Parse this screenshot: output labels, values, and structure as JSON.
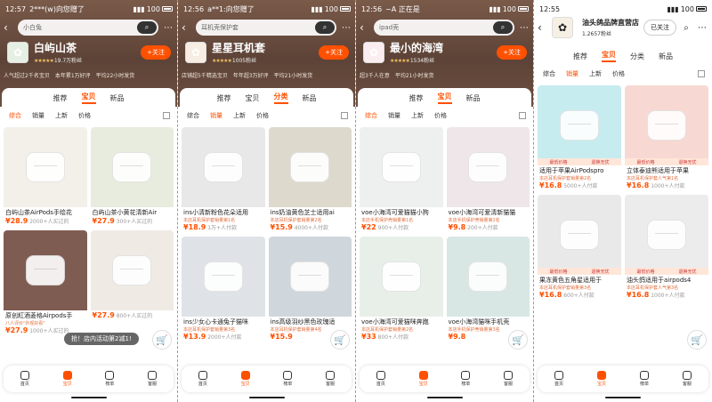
{
  "panels": [
    {
      "theme": "dark",
      "status": {
        "time": "12:57",
        "carrier": "2***(w)向您赠了",
        "battery": "100"
      },
      "search": {
        "query": "小白兔"
      },
      "shop": {
        "name": "白屿山茶",
        "fans": "19.7万粉丝",
        "follow": "+关注",
        "logo_color": "#e6efe3"
      },
      "tags": [
        "人气超过2千名宝贝",
        "本年累1万好评",
        "平均22小时发货"
      ],
      "tabs": [
        "推荐",
        "宝贝",
        "新品"
      ],
      "active_tab": 1,
      "sorts": [
        "综合",
        "销量",
        "上新",
        "价格"
      ],
      "active_sort": 0,
      "columns": [
        [
          {
            "title": "白屿山茶AirPods手绘花",
            "sub": "",
            "price": "¥28.9",
            "sales": "2000+人买过的",
            "img": "#f3f0ea"
          },
          {
            "title": "原创紅酒菱格Airpods手",
            "sub": "八人评价\"外观好看\"",
            "price": "¥27.9",
            "sales": "1000+人买过的",
            "img": "#7f5c52"
          }
        ],
        [
          {
            "title": "白屿山茶小黄花清新Air",
            "sub": "",
            "price": "¥27.9",
            "sales": "300+人买过的",
            "img": "#e7ecde"
          },
          {
            "title": "",
            "sub": "",
            "price": "¥27.9",
            "sales": "800+人买过的",
            "img": "#efeae4"
          }
        ]
      ],
      "toast": "抢！店内活动第2减1!",
      "nav": [
        "首页",
        "宝贝",
        "榜单",
        "客服"
      ],
      "active_nav": 1
    },
    {
      "theme": "dark",
      "status": {
        "time": "12:56",
        "carrier": "a**1:向您赠了",
        "battery": "100"
      },
      "search": {
        "query": "耳机壳保护套"
      },
      "shop": {
        "name": "星星耳机套",
        "fans": "1005粉丝",
        "follow": "+关注",
        "logo_color": "#f7ede2"
      },
      "tags": [
        "店铺超5千精选宝贝",
        "年年超3万好评",
        "平均21小时发货"
      ],
      "tabs": [
        "推荐",
        "宝贝",
        "分类",
        "新品"
      ],
      "active_tab": 2,
      "sorts": [
        "综合",
        "销量",
        "上新",
        "价格"
      ],
      "active_sort": 1,
      "columns": [
        [
          {
            "title": "ins小清新粉色花朵适用",
            "sub": "本店耳机保护套销量第1名",
            "price": "¥18.9",
            "sales": "1万+人付款",
            "img": "#e8e8e8"
          },
          {
            "title": "ins少女心卡通兔子猫咪",
            "sub": "本店耳机保护套销量第3名",
            "price": "¥13.9",
            "sales": "2000+人付款",
            "img": "#dfe3e8"
          }
        ],
        [
          {
            "title": "ins奶油黄色芝士适用ai",
            "sub": "本店耳机保护套销量第2名",
            "price": "¥15.9",
            "sales": "4000+人付款",
            "img": "#ddd9cd"
          },
          {
            "title": "ins高级羽纱黑色玫瑰适",
            "sub": "本店耳机保护套销量第4名",
            "price": "¥15.9",
            "sales": "",
            "img": "#cfd6dc"
          }
        ]
      ],
      "toast": "",
      "nav": [
        "首页",
        "宝贝",
        "榜单",
        "客服"
      ],
      "active_nav": 1
    },
    {
      "theme": "dark",
      "status": {
        "time": "12:56",
        "carrier": "~A 正在是",
        "battery": "100"
      },
      "search": {
        "query": "ipad壳"
      },
      "shop": {
        "name": "最小的海湾",
        "fans": "1534粉丝",
        "follow": "+关注",
        "logo_color": "#fbeef0"
      },
      "tags": [
        "超3千人在意",
        "平均21小时发货"
      ],
      "tabs": [
        "推荐",
        "宝贝",
        "新品"
      ],
      "active_tab": 1,
      "sorts": [
        "综合",
        "销量",
        "上新",
        "价格"
      ],
      "active_sort": 0,
      "columns": [
        [
          {
            "title": "voe小海湾可爱猫猫小狗",
            "sub": "本店手机保护壳销量第1名",
            "price": "¥22",
            "sales": "900+人付款",
            "img": "#eef0ef"
          },
          {
            "title": "voe小海湾可爱猫咪奔跑",
            "sub": "本店耳机保护套销量第2名",
            "price": "¥33",
            "sales": "800+人付款",
            "img": "#e8efe9"
          }
        ],
        [
          {
            "title": "voe小海湾可爱清新猫猫",
            "sub": "本店手机保护壳销量第2名",
            "price": "¥9.8",
            "sales": "200+人付款",
            "img": "#efe6e9"
          },
          {
            "title": "voe小海湾猫咪手机壳",
            "sub": "本店手机保护壳销量第3名",
            "price": "¥9.8",
            "sales": "",
            "img": "#d8e7e4"
          }
        ]
      ],
      "toast": "",
      "nav": [
        "首页",
        "宝贝",
        "榜单",
        "客服"
      ],
      "active_nav": 1
    },
    {
      "theme": "light",
      "status": {
        "time": "12:55",
        "carrier": "",
        "battery": "100"
      },
      "search": {
        "query": ""
      },
      "shop": {
        "name": "油头鸽品牌直营店",
        "fans": "1.2657粉丝",
        "follow": "已关注",
        "logo_color": "#f6efe3"
      },
      "tags": [],
      "tabs": [
        "推荐",
        "宝贝",
        "分类",
        "新品"
      ],
      "active_tab": 1,
      "sorts": [
        "综合",
        "销量",
        "上新",
        "价格"
      ],
      "active_sort": 1,
      "columns": [
        [
          {
            "title": "适用于苹果AirPodspro",
            "sub": "本店耳机保护套销量第2名",
            "price": "¥16.8",
            "sales": "5000+人付款",
            "img": "#c7ecf0",
            "badge": [
              "最低价格",
              "退换无忧"
            ]
          },
          {
            "title": "果冻黄色五角星适用于",
            "sub": "本店耳机保护套销量第3名",
            "price": "¥16.8",
            "sales": "600+人付款",
            "img": "#e9e9e9",
            "badge": [
              "最低价格",
              "退换无忧"
            ]
          }
        ],
        [
          {
            "title": "立体泰迪熊适用于苹果",
            "sub": "本店耳机保护套人气第1名",
            "price": "¥16.8",
            "sales": "1000+人付款",
            "img": "#f7d8d2",
            "badge": [
              "最低价格",
              "退换无忧"
            ]
          },
          {
            "title": "油头鸽适用于airpods4",
            "sub": "本店耳机保护套人气第3名",
            "price": "¥16.8",
            "sales": "1000+人付款",
            "img": "#ececec",
            "badge": [
              "最低价格",
              "退换无忧"
            ]
          }
        ]
      ],
      "toast": "",
      "nav": [
        "首页",
        "宝贝",
        "榜单",
        "客服"
      ],
      "active_nav": 1
    }
  ]
}
